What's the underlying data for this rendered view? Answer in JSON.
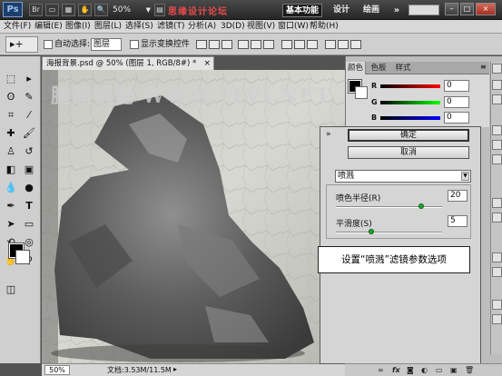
{
  "title_bar": {
    "logo": "Ps",
    "zoom": "50%",
    "watermark": "思缘设计论坛",
    "workspace_active": "基本功能",
    "workspace_design": "设计",
    "workspace_paint": "绘画",
    "more": "»",
    "window_minimize": "–",
    "window_restore": "□",
    "window_close": "×"
  },
  "menu": {
    "items": [
      "文件(F)",
      "编辑(E)",
      "图像(I)",
      "图层(L)",
      "选择(S)",
      "滤镜(T)",
      "分析(A)",
      "3D(D)",
      "视图(V)",
      "窗口(W)",
      "帮助(H)"
    ]
  },
  "options_bar": {
    "tool": "▸+",
    "auto_select_label": "自动选择:",
    "auto_select_value": "图层",
    "show_transform_label": "显示变换控件"
  },
  "document": {
    "tab_title": "海报背景.psd @ 50% (图层 1, RGB/8#) *",
    "tab_close": "×",
    "watermark": "騰龍視覺 WWW.TLVI.NET",
    "zoom_status": "50%",
    "doc_info": "文档:3.53M/11.5M"
  },
  "color_panel": {
    "tabs": [
      "颜色",
      "色板",
      "样式"
    ],
    "r_label": "R",
    "g_label": "G",
    "b_label": "B",
    "r_value": "0",
    "g_value": "0",
    "b_value": "0"
  },
  "filter_dialog": {
    "ok_label": "确定",
    "cancel_label": "取消",
    "filter_name": "喷溅",
    "param1_label": "喷色半径(R)",
    "param1_value": "20",
    "param1_level": 0.8,
    "param2_label": "平滑度(S)",
    "param2_value": "5",
    "param2_level": 0.33,
    "collapse": "»"
  },
  "callout": {
    "text": "设置“喷溅”滤镜参数选项"
  },
  "colors": {
    "title_bg": "#2b2b2b",
    "accent_red": "#e94c4c",
    "slider_green": "#17a92d"
  }
}
